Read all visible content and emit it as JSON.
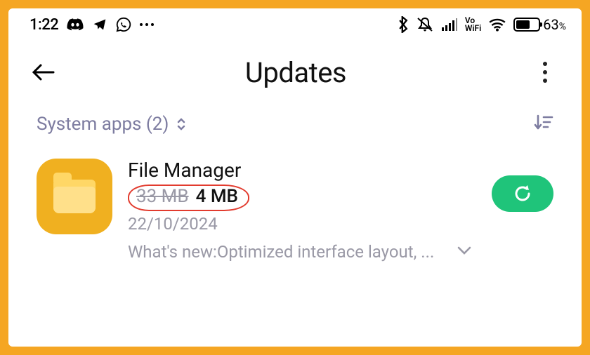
{
  "status": {
    "time": "1:22",
    "vowifi_top": "Vo",
    "vowifi_bottom": "WiFi",
    "battery_pct": "63",
    "battery_fill_pct": 63
  },
  "header": {
    "title": "Updates"
  },
  "filter": {
    "label": "System apps (2)"
  },
  "app": {
    "name": "File Manager",
    "size_old": "33 MB",
    "size_new": "4 MB",
    "date": "22/10/2024",
    "whatsnew": "What's new:Optimized interface layout, ..."
  }
}
